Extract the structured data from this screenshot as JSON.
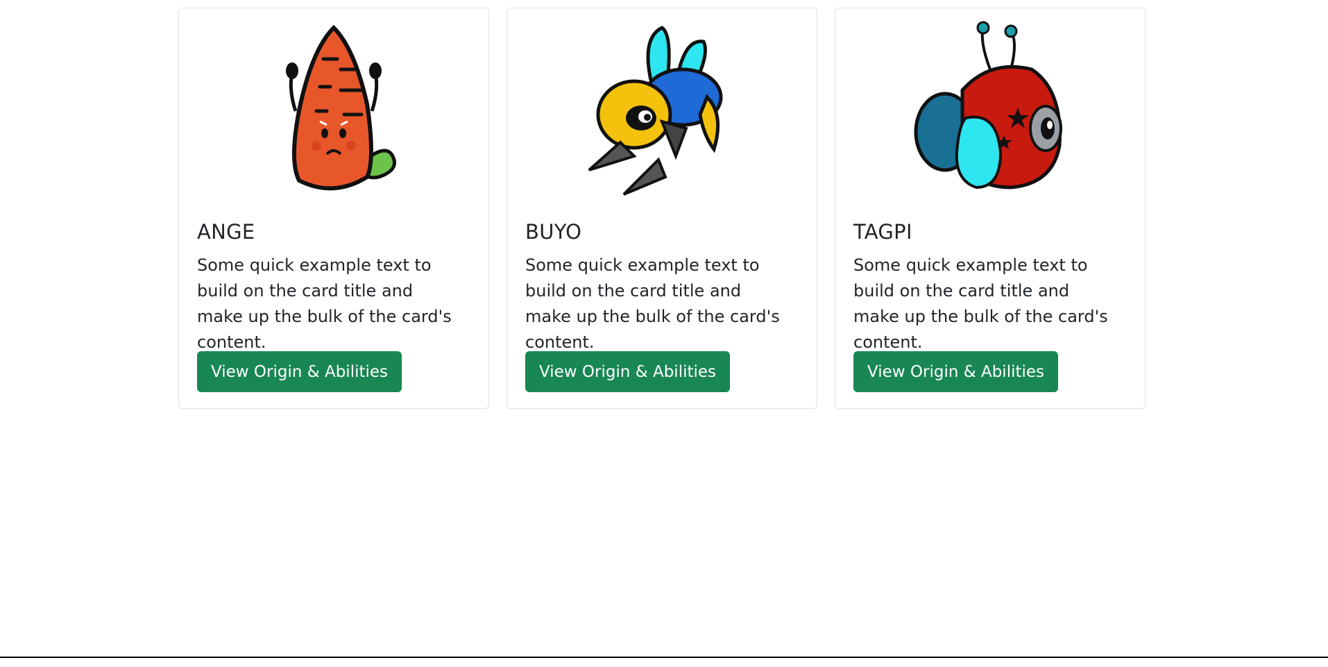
{
  "cards": [
    {
      "title": "ANGE",
      "text": "Some quick example text to build on the card title and make up the bulk of the card's content.",
      "button_label": "View Origin & Abilities",
      "image_icon": "carrot-monster-icon"
    },
    {
      "title": "BUYO",
      "text": "Some quick example text to build on the card title and make up the bulk of the card's content.",
      "button_label": "View Origin & Abilities",
      "image_icon": "bee-monster-icon"
    },
    {
      "title": "TAGPI",
      "text": "Some quick example text to build on the card title and make up the bulk of the card's content.",
      "button_label": "View Origin & Abilities",
      "image_icon": "ladybug-monster-icon"
    }
  ],
  "colors": {
    "button": "#198754",
    "card_border": "#dee2e6",
    "text": "#212529"
  }
}
